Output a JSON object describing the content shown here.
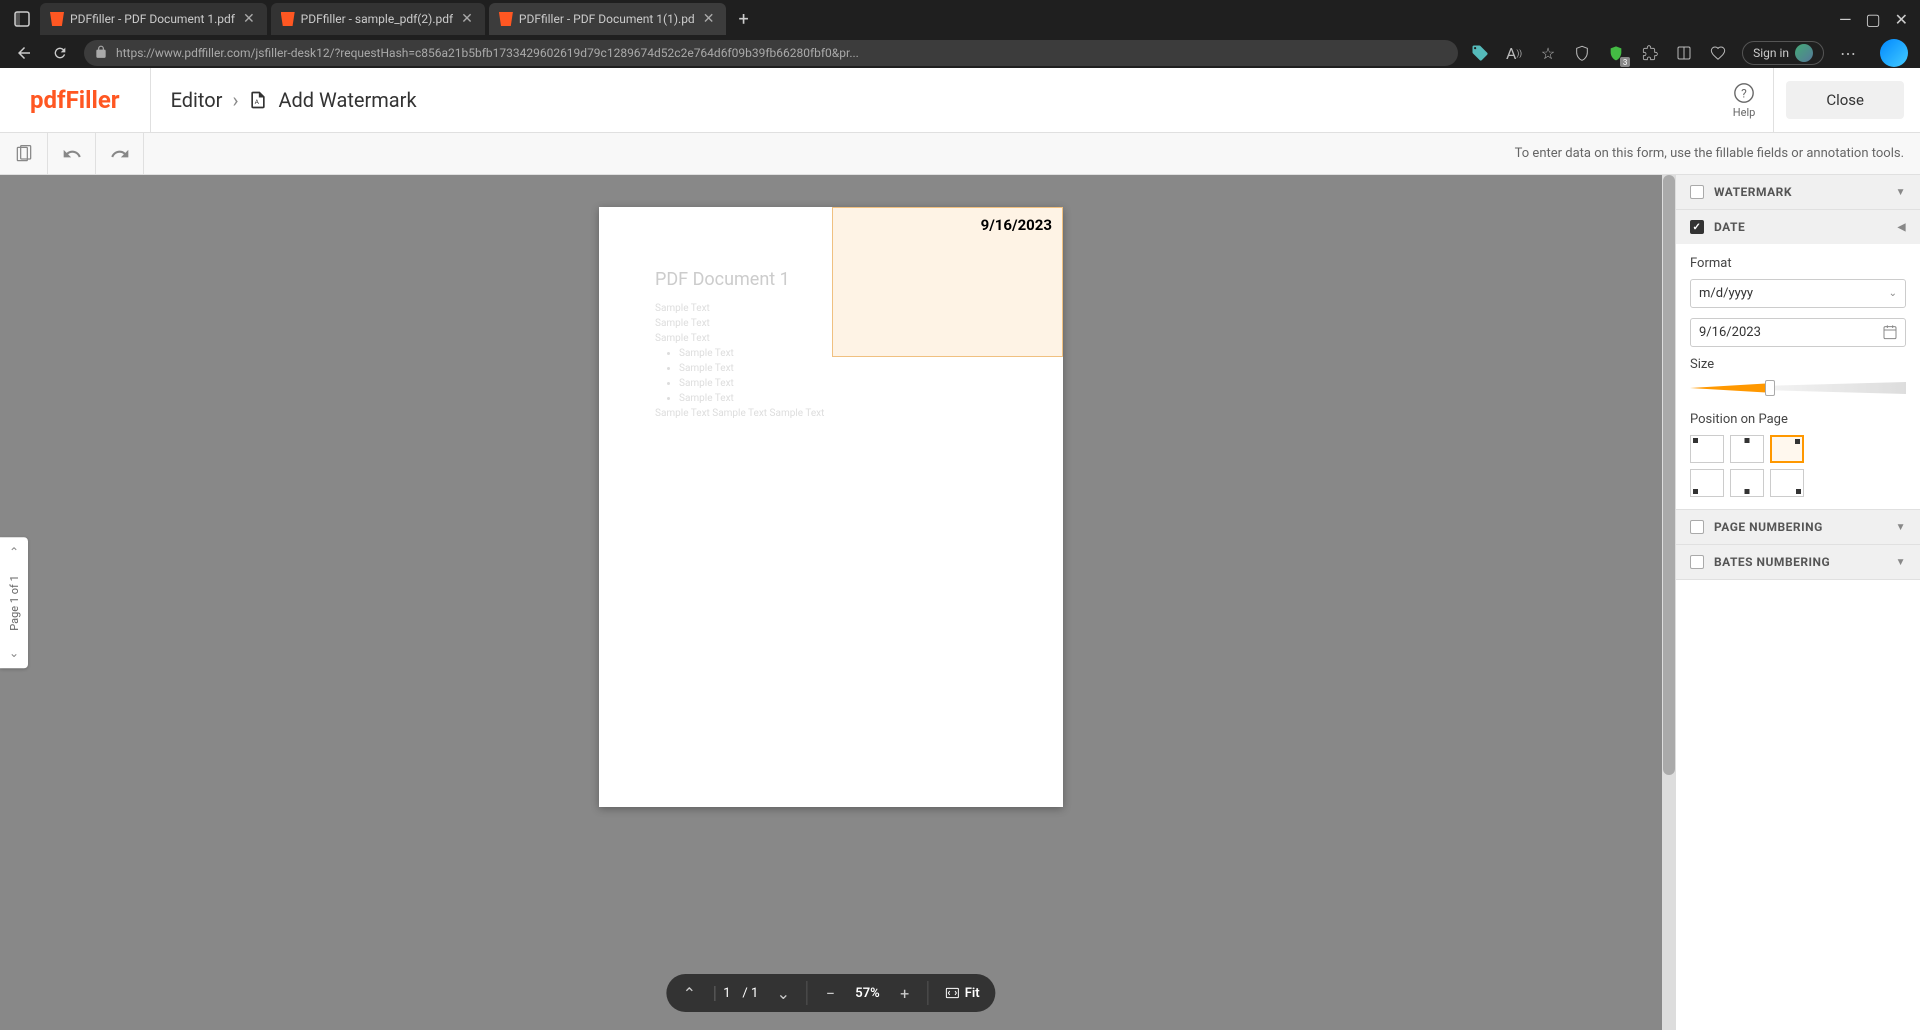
{
  "browser": {
    "tabs": [
      {
        "title": "PDFfiller - PDF Document 1.pdf",
        "active": false
      },
      {
        "title": "PDFfiller - sample_pdf(2).pdf",
        "active": false
      },
      {
        "title": "PDFfiller - PDF Document 1(1).pd",
        "active": true
      }
    ],
    "url": "https://www.pdffiller.com/jsfiller-desk12/?requestHash=c856a21b5bfb1733429602619d79c1289674d52c2e764d6f09b39fb66280fbf0&pr...",
    "sign_in": "Sign in"
  },
  "header": {
    "logo": "pdfFiller",
    "breadcrumb_root": "Editor",
    "breadcrumb_current": "Add Watermark",
    "help_label": "Help",
    "close_label": "Close"
  },
  "toolbar": {
    "hint": "To enter data on this form, use the fillable fields or annotation tools."
  },
  "page_nav": {
    "label": "Page 1 of 1"
  },
  "document": {
    "title": "PDF Document 1",
    "lines": [
      "Sample Text",
      "Sample Text",
      "Sample Text"
    ],
    "bullets": [
      "Sample Text",
      "Sample Text",
      "Sample Text",
      "Sample Text"
    ],
    "footer_line": "Sample Text Sample Text Sample Text",
    "watermark_date": "9/16/2023"
  },
  "zoom_bar": {
    "page_current": "1",
    "page_total": "/ 1",
    "zoom": "57%",
    "fit_label": "Fit"
  },
  "sidebar": {
    "sections": {
      "watermark": {
        "label": "WATERMARK",
        "checked": false,
        "expanded": false
      },
      "date": {
        "label": "DATE",
        "checked": true,
        "expanded": true,
        "format_label": "Format",
        "format_value": "m/d/yyyy",
        "date_value": "9/16/2023",
        "size_label": "Size",
        "position_label": "Position on Page",
        "selected_position": "tr"
      },
      "page_numbering": {
        "label": "PAGE NUMBERING",
        "checked": false,
        "expanded": false
      },
      "bates_numbering": {
        "label": "BATES NUMBERING",
        "checked": false,
        "expanded": false
      }
    }
  }
}
